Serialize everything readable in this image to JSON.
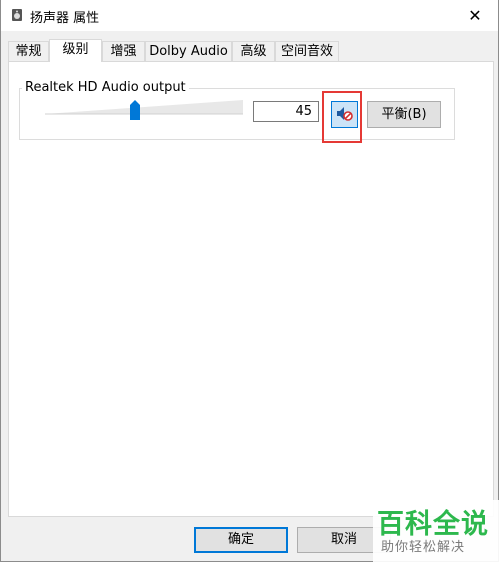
{
  "window": {
    "title": "扬声器 属性",
    "close_glyph": "✕"
  },
  "tabs": [
    {
      "label": "常规"
    },
    {
      "label": "级别"
    },
    {
      "label": "增强"
    },
    {
      "label": "Dolby Audio"
    },
    {
      "label": "高级"
    },
    {
      "label": "空间音效"
    }
  ],
  "active_tab": "级别",
  "levels": {
    "device_label": "Realtek HD Audio output",
    "level_value": "45",
    "slider_level_percent": 45,
    "mute_icon": "speaker-muted-icon",
    "balance_label": "平衡(B)"
  },
  "buttons": {
    "ok_label": "确定",
    "cancel_label": "取消"
  },
  "watermark": {
    "main": "百科全说",
    "sub": "助你轻松解决"
  },
  "colors": {
    "accent": "#0078d7",
    "highlight": "#e53935",
    "watermark_green": "#2db84d"
  }
}
